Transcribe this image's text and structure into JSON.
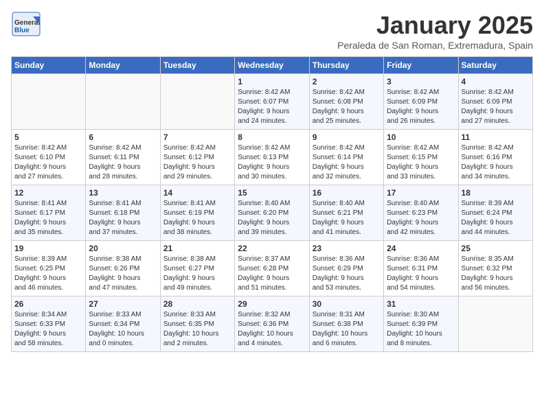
{
  "logo": {
    "general": "General",
    "blue": "Blue"
  },
  "header": {
    "month": "January 2025",
    "location": "Peraleda de San Roman, Extremadura, Spain"
  },
  "weekdays": [
    "Sunday",
    "Monday",
    "Tuesday",
    "Wednesday",
    "Thursday",
    "Friday",
    "Saturday"
  ],
  "weeks": [
    [
      {
        "day": "",
        "info": ""
      },
      {
        "day": "",
        "info": ""
      },
      {
        "day": "",
        "info": ""
      },
      {
        "day": "1",
        "info": "Sunrise: 8:42 AM\nSunset: 6:07 PM\nDaylight: 9 hours\nand 24 minutes."
      },
      {
        "day": "2",
        "info": "Sunrise: 8:42 AM\nSunset: 6:08 PM\nDaylight: 9 hours\nand 25 minutes."
      },
      {
        "day": "3",
        "info": "Sunrise: 8:42 AM\nSunset: 6:09 PM\nDaylight: 9 hours\nand 26 minutes."
      },
      {
        "day": "4",
        "info": "Sunrise: 8:42 AM\nSunset: 6:09 PM\nDaylight: 9 hours\nand 27 minutes."
      }
    ],
    [
      {
        "day": "5",
        "info": "Sunrise: 8:42 AM\nSunset: 6:10 PM\nDaylight: 9 hours\nand 27 minutes."
      },
      {
        "day": "6",
        "info": "Sunrise: 8:42 AM\nSunset: 6:11 PM\nDaylight: 9 hours\nand 28 minutes."
      },
      {
        "day": "7",
        "info": "Sunrise: 8:42 AM\nSunset: 6:12 PM\nDaylight: 9 hours\nand 29 minutes."
      },
      {
        "day": "8",
        "info": "Sunrise: 8:42 AM\nSunset: 6:13 PM\nDaylight: 9 hours\nand 30 minutes."
      },
      {
        "day": "9",
        "info": "Sunrise: 8:42 AM\nSunset: 6:14 PM\nDaylight: 9 hours\nand 32 minutes."
      },
      {
        "day": "10",
        "info": "Sunrise: 8:42 AM\nSunset: 6:15 PM\nDaylight: 9 hours\nand 33 minutes."
      },
      {
        "day": "11",
        "info": "Sunrise: 8:42 AM\nSunset: 6:16 PM\nDaylight: 9 hours\nand 34 minutes."
      }
    ],
    [
      {
        "day": "12",
        "info": "Sunrise: 8:41 AM\nSunset: 6:17 PM\nDaylight: 9 hours\nand 35 minutes."
      },
      {
        "day": "13",
        "info": "Sunrise: 8:41 AM\nSunset: 6:18 PM\nDaylight: 9 hours\nand 37 minutes."
      },
      {
        "day": "14",
        "info": "Sunrise: 8:41 AM\nSunset: 6:19 PM\nDaylight: 9 hours\nand 38 minutes."
      },
      {
        "day": "15",
        "info": "Sunrise: 8:40 AM\nSunset: 6:20 PM\nDaylight: 9 hours\nand 39 minutes."
      },
      {
        "day": "16",
        "info": "Sunrise: 8:40 AM\nSunset: 6:21 PM\nDaylight: 9 hours\nand 41 minutes."
      },
      {
        "day": "17",
        "info": "Sunrise: 8:40 AM\nSunset: 6:23 PM\nDaylight: 9 hours\nand 42 minutes."
      },
      {
        "day": "18",
        "info": "Sunrise: 8:39 AM\nSunset: 6:24 PM\nDaylight: 9 hours\nand 44 minutes."
      }
    ],
    [
      {
        "day": "19",
        "info": "Sunrise: 8:39 AM\nSunset: 6:25 PM\nDaylight: 9 hours\nand 46 minutes."
      },
      {
        "day": "20",
        "info": "Sunrise: 8:38 AM\nSunset: 6:26 PM\nDaylight: 9 hours\nand 47 minutes."
      },
      {
        "day": "21",
        "info": "Sunrise: 8:38 AM\nSunset: 6:27 PM\nDaylight: 9 hours\nand 49 minutes."
      },
      {
        "day": "22",
        "info": "Sunrise: 8:37 AM\nSunset: 6:28 PM\nDaylight: 9 hours\nand 51 minutes."
      },
      {
        "day": "23",
        "info": "Sunrise: 8:36 AM\nSunset: 6:29 PM\nDaylight: 9 hours\nand 53 minutes."
      },
      {
        "day": "24",
        "info": "Sunrise: 8:36 AM\nSunset: 6:31 PM\nDaylight: 9 hours\nand 54 minutes."
      },
      {
        "day": "25",
        "info": "Sunrise: 8:35 AM\nSunset: 6:32 PM\nDaylight: 9 hours\nand 56 minutes."
      }
    ],
    [
      {
        "day": "26",
        "info": "Sunrise: 8:34 AM\nSunset: 6:33 PM\nDaylight: 9 hours\nand 58 minutes."
      },
      {
        "day": "27",
        "info": "Sunrise: 8:33 AM\nSunset: 6:34 PM\nDaylight: 10 hours\nand 0 minutes."
      },
      {
        "day": "28",
        "info": "Sunrise: 8:33 AM\nSunset: 6:35 PM\nDaylight: 10 hours\nand 2 minutes."
      },
      {
        "day": "29",
        "info": "Sunrise: 8:32 AM\nSunset: 6:36 PM\nDaylight: 10 hours\nand 4 minutes."
      },
      {
        "day": "30",
        "info": "Sunrise: 8:31 AM\nSunset: 6:38 PM\nDaylight: 10 hours\nand 6 minutes."
      },
      {
        "day": "31",
        "info": "Sunrise: 8:30 AM\nSunset: 6:39 PM\nDaylight: 10 hours\nand 8 minutes."
      },
      {
        "day": "",
        "info": ""
      }
    ]
  ]
}
